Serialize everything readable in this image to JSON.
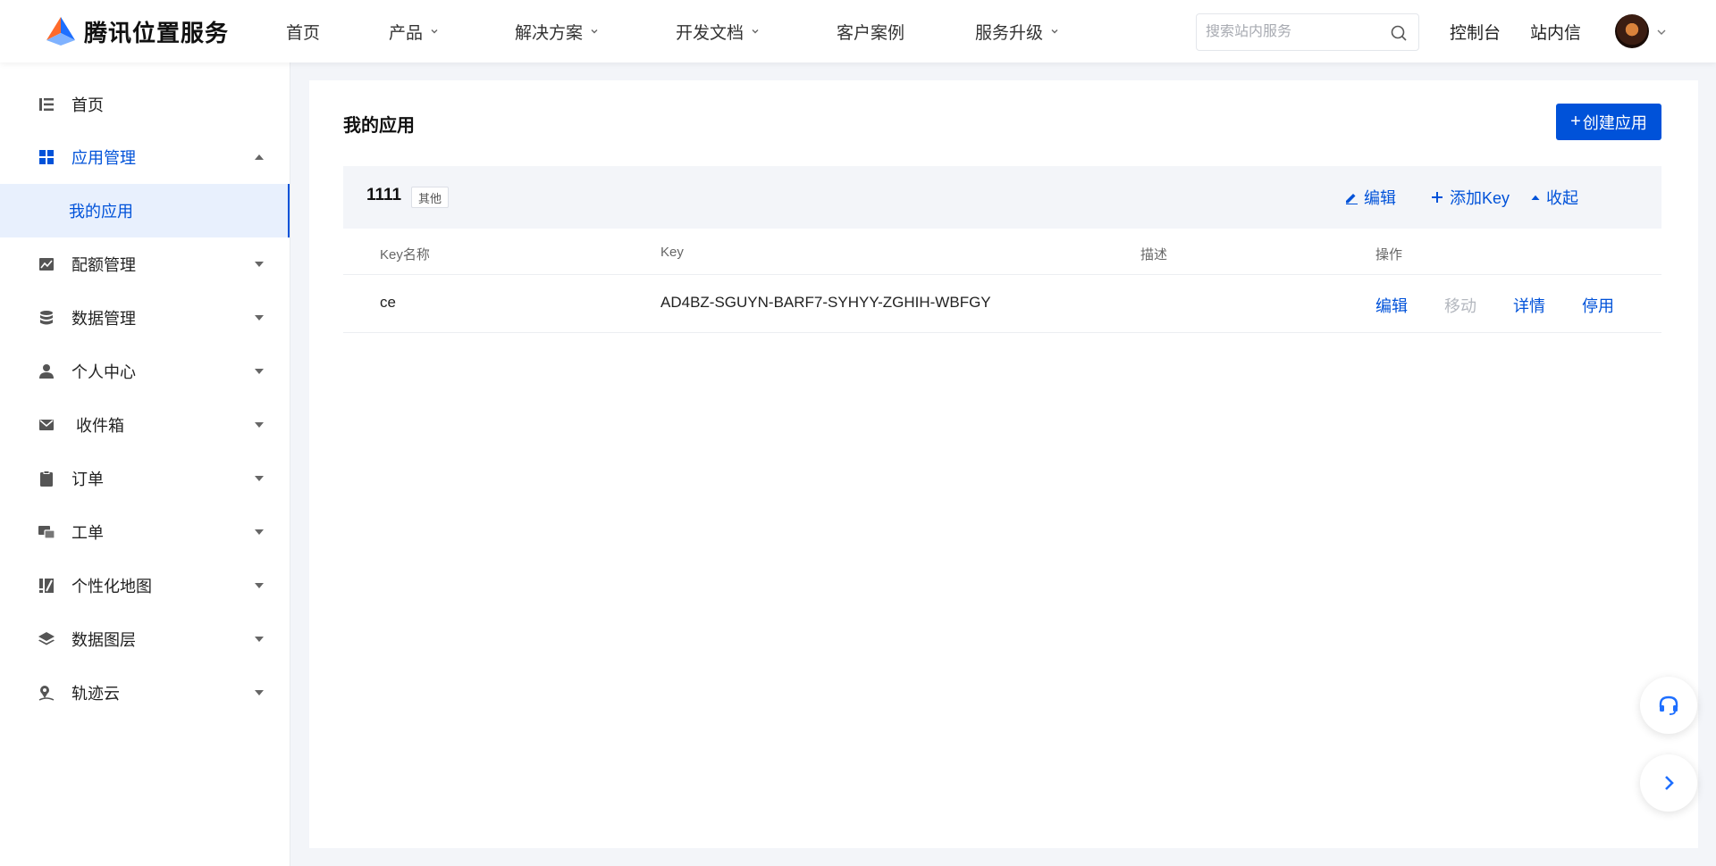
{
  "brand": {
    "name": "腾讯位置服务"
  },
  "nav": {
    "items": [
      {
        "label": "首页",
        "has_dropdown": false
      },
      {
        "label": "产品",
        "has_dropdown": true
      },
      {
        "label": "解决方案",
        "has_dropdown": true
      },
      {
        "label": "开发文档",
        "has_dropdown": true
      },
      {
        "label": "客户案例",
        "has_dropdown": false
      },
      {
        "label": "服务升级",
        "has_dropdown": true
      }
    ],
    "search_placeholder": "搜索站内服务",
    "console": "控制台",
    "messages": "站内信"
  },
  "sidebar": {
    "items": [
      {
        "label": "首页",
        "icon": "list-icon"
      },
      {
        "label": "应用管理",
        "icon": "grid-icon",
        "expanded": true
      },
      {
        "label": "配额管理",
        "icon": "chart-icon"
      },
      {
        "label": "数据管理",
        "icon": "database-icon"
      },
      {
        "label": "个人中心",
        "icon": "user-icon"
      },
      {
        "label": " 收件箱",
        "icon": "mail-icon"
      },
      {
        "label": "订单",
        "icon": "clipboard-icon"
      },
      {
        "label": "工单",
        "icon": "ticket-icon"
      },
      {
        "label": "个性化地图",
        "icon": "custom-map-icon"
      },
      {
        "label": "数据图层",
        "icon": "layers-icon"
      },
      {
        "label": "轨迹云",
        "icon": "track-icon"
      }
    ],
    "sub_item": "我的应用"
  },
  "main": {
    "title": "我的应用",
    "create_button": "创建应用",
    "app": {
      "name": "1111",
      "tag": "其他",
      "actions": {
        "edit": "编辑",
        "add_key": "添加Key",
        "collapse": "收起"
      }
    },
    "table": {
      "columns": [
        "Key名称",
        "Key",
        "描述",
        "操作"
      ],
      "rows": [
        {
          "name": "ce",
          "key": "AD4BZ-SGUYN-BARF7-SYHYY-ZGHIH-WBFGY",
          "desc": "",
          "ops": [
            "编辑",
            "移动",
            "详情",
            "停用"
          ]
        }
      ]
    }
  },
  "colors": {
    "accent": "#0052d9",
    "disabled": "#b4b8bf",
    "bg": "#f3f5f9"
  }
}
